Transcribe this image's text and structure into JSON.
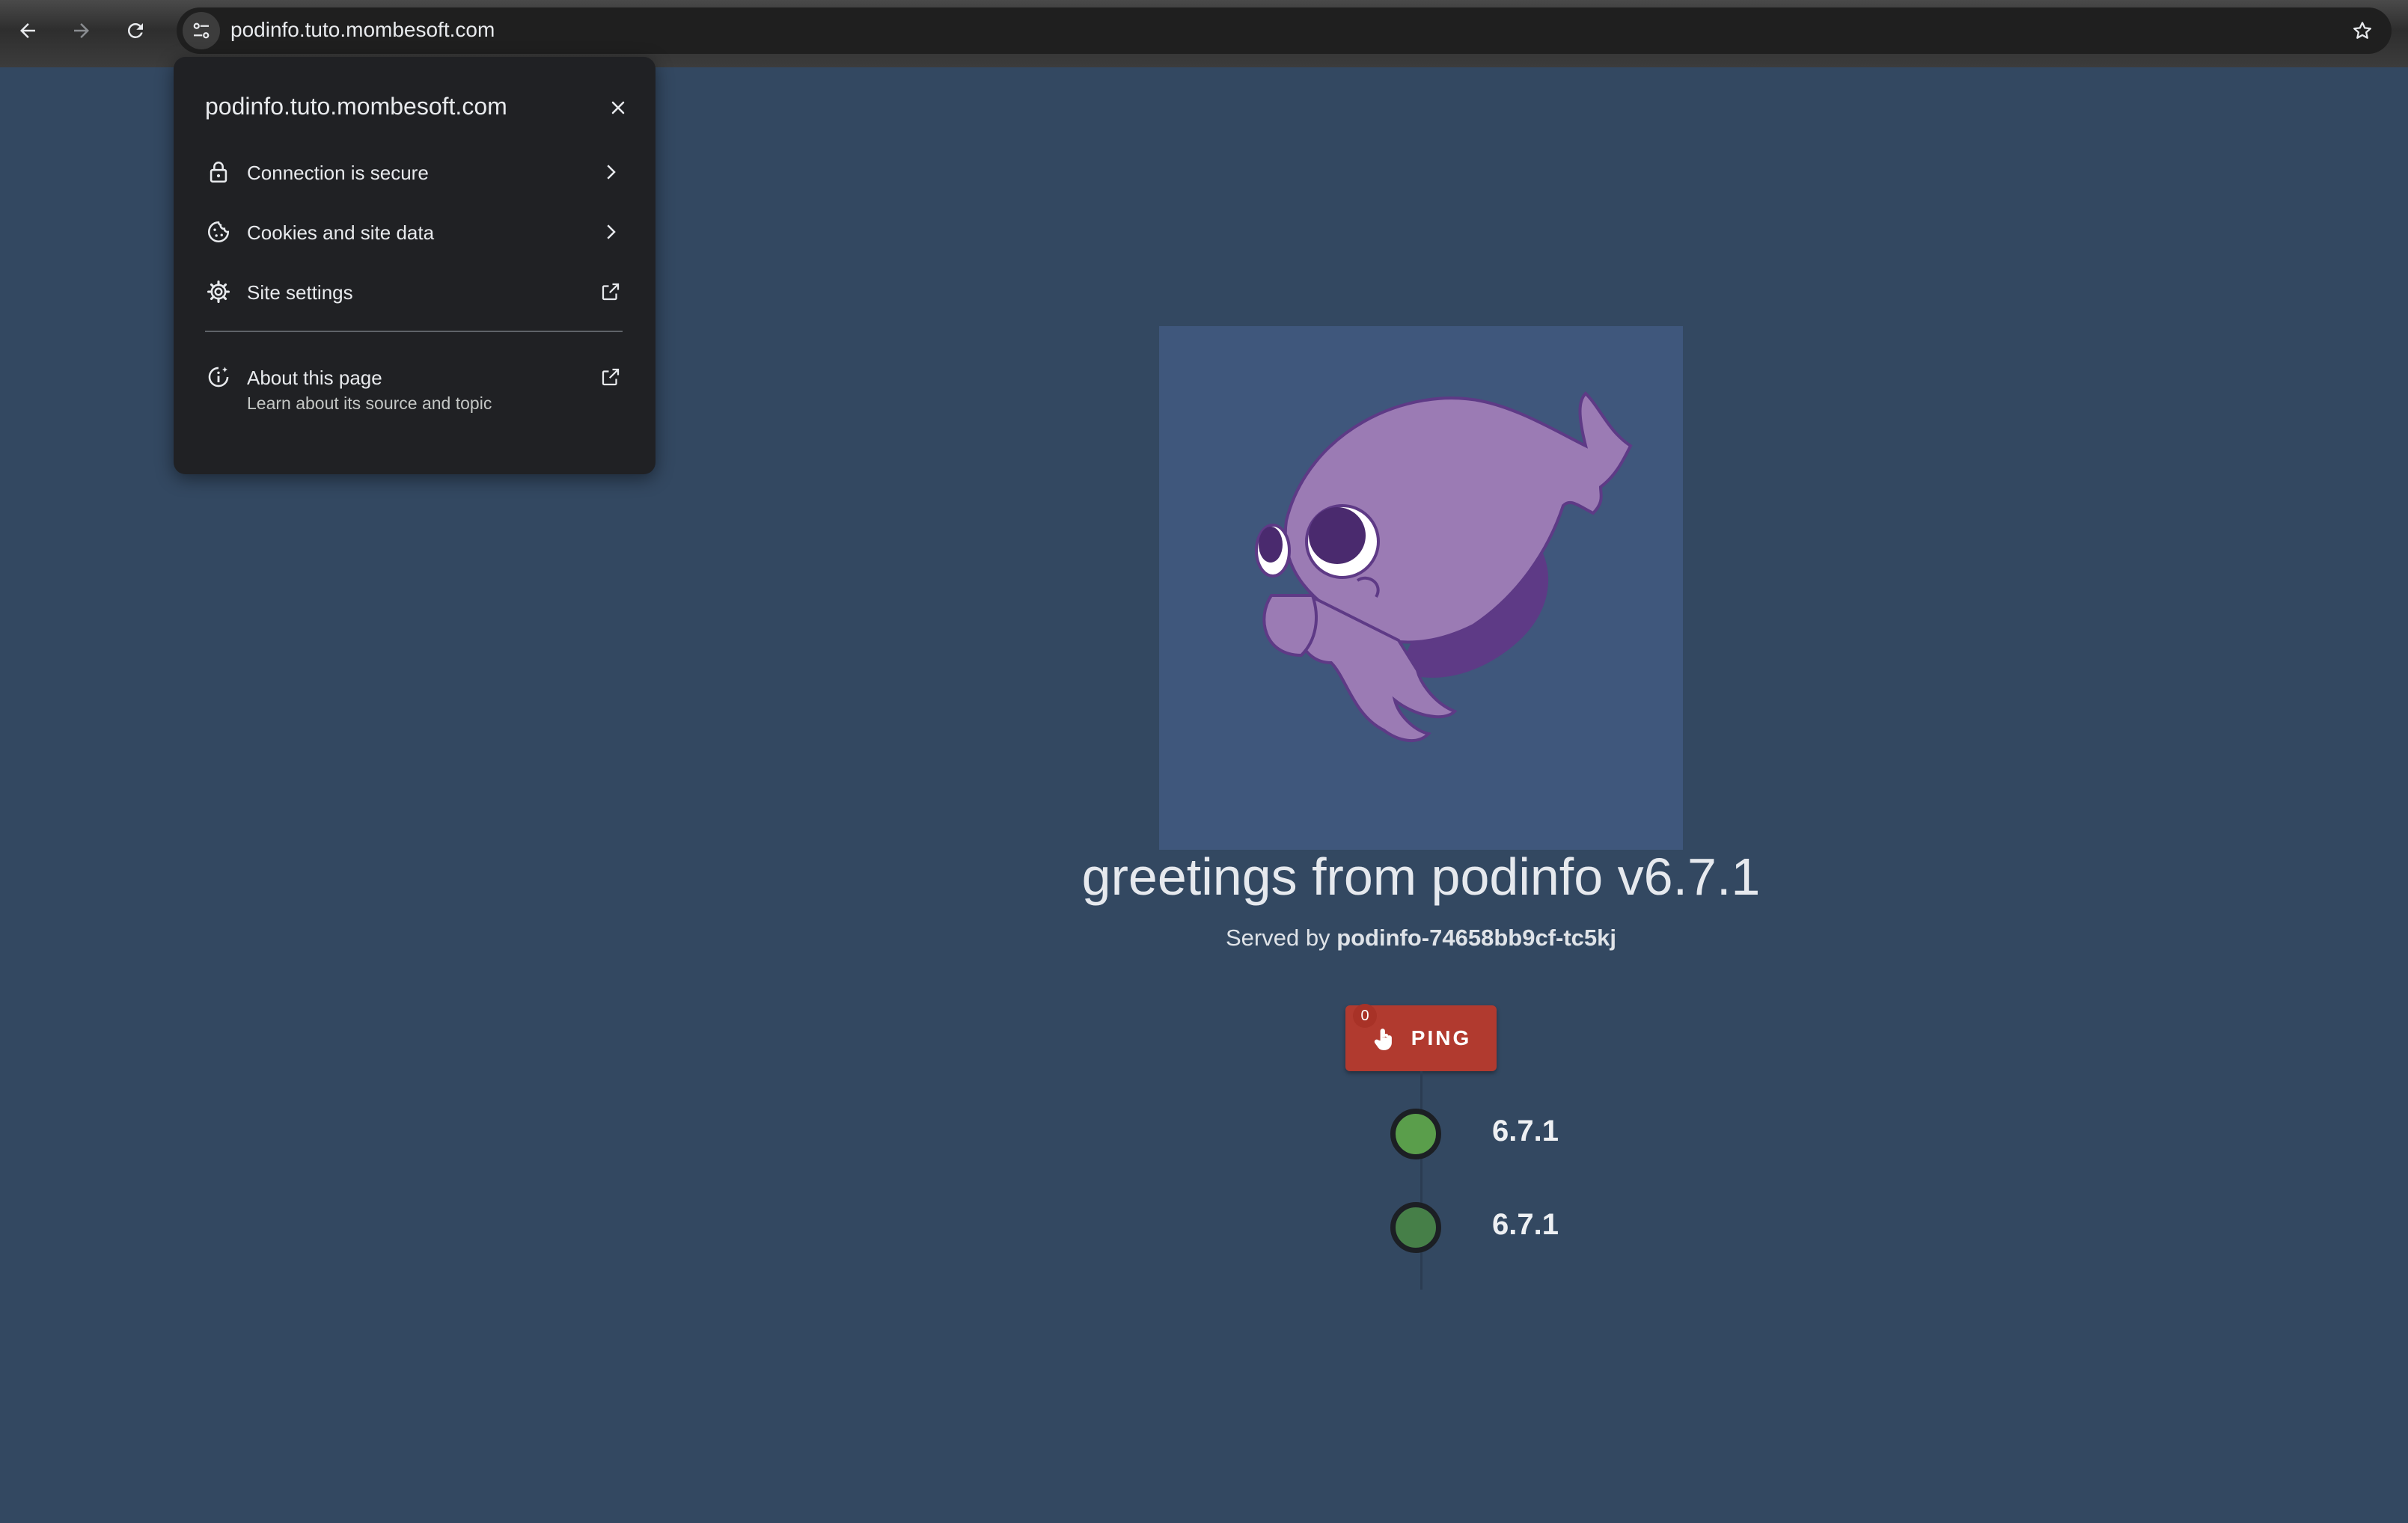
{
  "browser": {
    "url": "podinfo.tuto.mombesoft.com",
    "back_icon": "arrow-left-icon",
    "forward_icon": "arrow-right-icon",
    "reload_icon": "reload-icon",
    "site_info_icon": "tune-icon",
    "bookmark_icon": "star-outline-icon"
  },
  "site_info_popup": {
    "title": "podinfo.tuto.mombesoft.com",
    "close_icon": "close-icon",
    "items": [
      {
        "label": "Connection is secure",
        "icon": "lock-icon",
        "trailing": "chevron-right-icon"
      },
      {
        "label": "Cookies and site data",
        "icon": "cookie-icon",
        "trailing": "chevron-right-icon"
      },
      {
        "label": "Site settings",
        "icon": "gear-icon",
        "trailing": "open-external-icon"
      }
    ],
    "about": {
      "label": "About this page",
      "sublabel": "Learn about its source and topic",
      "icon": "info-sparkle-icon",
      "trailing": "open-external-icon"
    }
  },
  "page": {
    "logo": "podinfo-cuttlefish-logo",
    "greeting": "greetings from podinfo v6.7.1",
    "served_prefix": "Served by ",
    "served_host": "podinfo-74658bb9cf-tc5kj",
    "ping_button": {
      "label": "PING",
      "badge_count": "0",
      "icon": "touch-icon"
    },
    "timeline": [
      {
        "version": "6.7.1",
        "dot_color": "#5a9e4b"
      },
      {
        "version": "6.7.1",
        "dot_color": "#467f48"
      }
    ]
  },
  "colors": {
    "page_background": "#334861",
    "logo_background": "#3f577c",
    "ping_button": "#b13a2f",
    "popup_background": "#202124"
  }
}
